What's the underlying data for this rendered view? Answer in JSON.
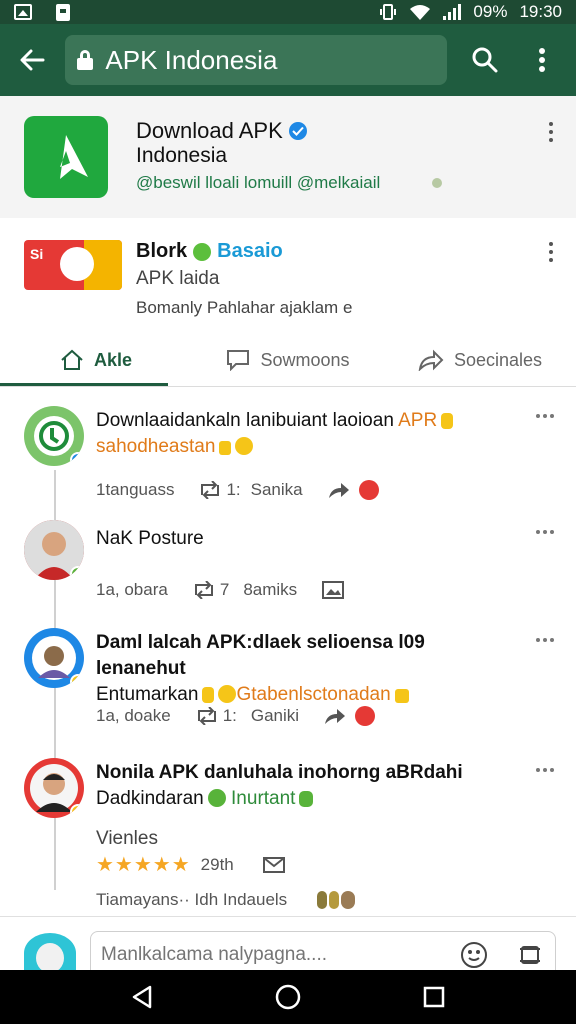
{
  "status_bar": {
    "battery": "09%",
    "time": "19:30"
  },
  "app_bar": {
    "url": "APK Indonesia"
  },
  "profile": {
    "name": "Download APK",
    "subtitle": "Indonesia",
    "handle": "@beswil lloali lomuill @melkaiail"
  },
  "card2": {
    "thumb_text": "Si",
    "title": "Blork",
    "title_accent": "Basaio",
    "subtitle": "APK laida",
    "meta": "Bomanly Pahlahar ajaklam e"
  },
  "tabs": [
    {
      "label": "Akle"
    },
    {
      "label": "Sowmoons"
    },
    {
      "label": "Soecinales"
    }
  ],
  "posts": [
    {
      "text": "Downlaaidankaln lanibuiant laoioan",
      "highlight": "APR",
      "text2": "sahodheastan",
      "stat1": "1tanguass",
      "stat2": "1:",
      "stat3": "Sanika"
    },
    {
      "text": "NaK Posture",
      "stat1": "1a, obara",
      "stat2": "7",
      "stat3": "8amiks"
    },
    {
      "text": "Daml lalcah APK:dlaek selioensa l09 lenanehut",
      "text2": "Entumarkan",
      "highlight": "Gtabenlsctonadan",
      "stat1": "1a, doake",
      "stat2": "1:",
      "stat3": "Ganiki"
    },
    {
      "text": "Nonila APK danluhala inohorng aBRdahi",
      "text2": "Dadkindaran",
      "highlight": "Inurtant",
      "label": "Vienles",
      "stars": "★★★★★",
      "rating_count": "29th",
      "footer": "Tiamayans·· Idh Indauels"
    }
  ],
  "composer": {
    "placeholder": "Manlkalcama nalypagna...."
  },
  "colors": {
    "app_bar": "#1f5c3f",
    "accent_green": "#20a83e",
    "link_blue": "#1a9ad6",
    "highlight_orange": "#e07b1a"
  }
}
